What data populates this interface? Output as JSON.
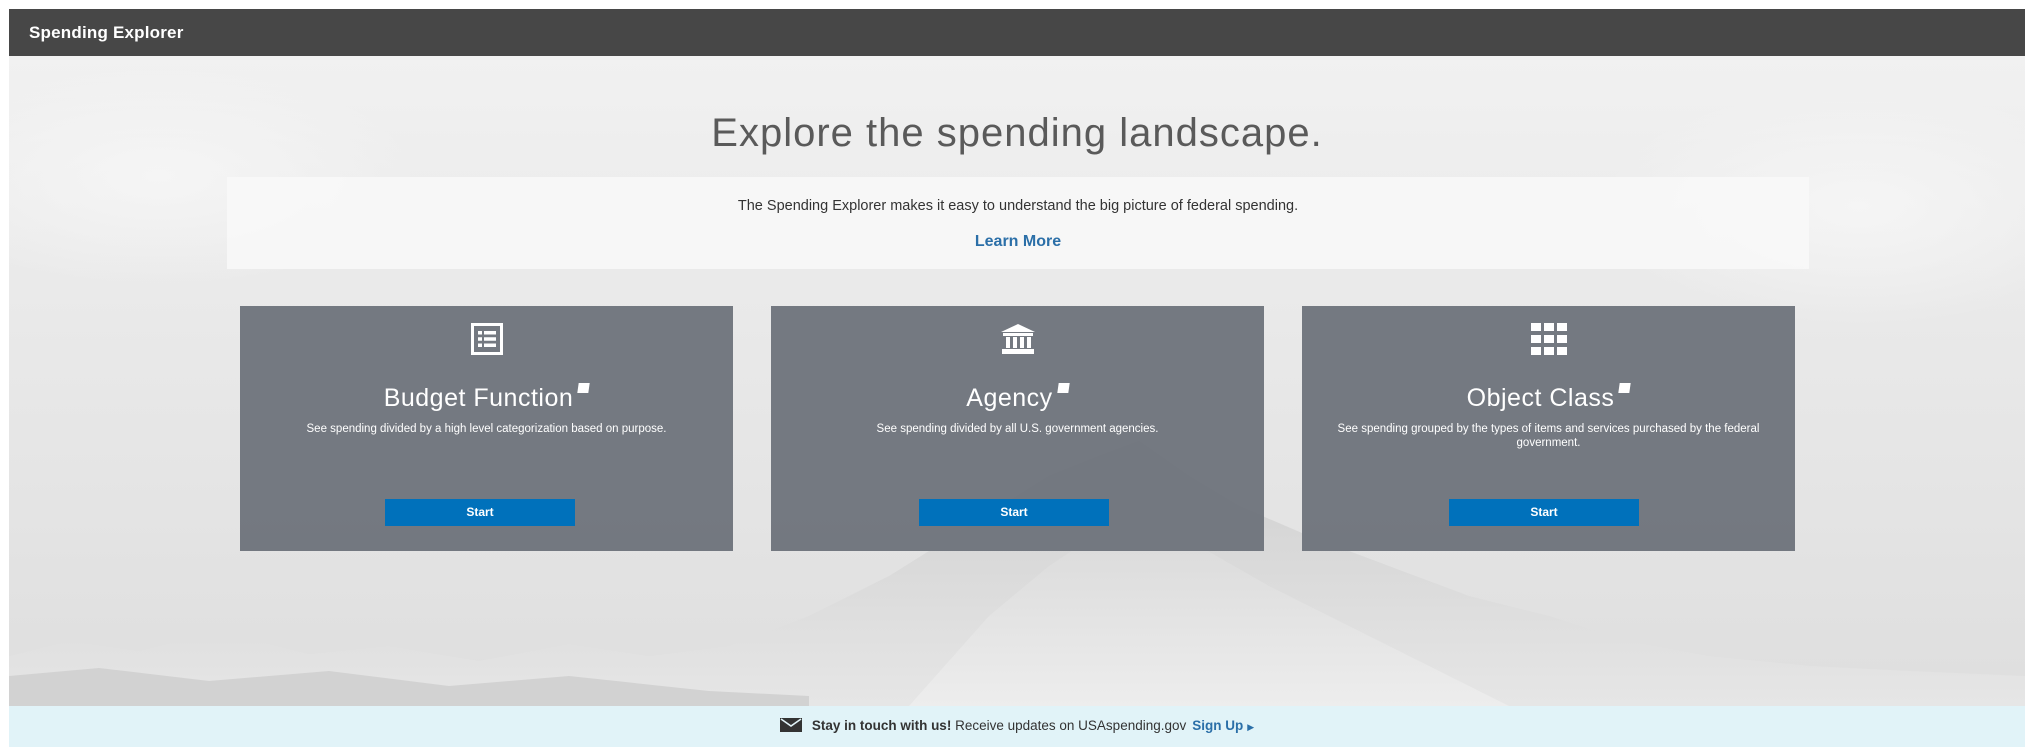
{
  "header": {
    "title": "Spending Explorer"
  },
  "hero": {
    "title": "Explore the spending landscape.",
    "intro": "The Spending Explorer makes it easy to understand the big picture of federal spending.",
    "learn_more": "Learn More"
  },
  "cards": [
    {
      "icon": "list-icon",
      "title": "Budget Function",
      "description": "See spending divided by a high level categorization based on purpose.",
      "button": "Start"
    },
    {
      "icon": "building-icon",
      "title": "Agency",
      "description": "See spending divided by all U.S. government agencies.",
      "button": "Start"
    },
    {
      "icon": "grid-icon",
      "title": "Object Class",
      "description": "See spending grouped by the types of items and services purchased by the federal government.",
      "button": "Start"
    }
  ],
  "footer": {
    "icon": "envelope-icon",
    "stay": "Stay in touch with us!",
    "text": "Receive updates on USAspending.gov",
    "signup": "Sign Up"
  },
  "colors": {
    "topbar": "#474747",
    "card": "#70757d",
    "button": "#0071bb",
    "link": "#2b6fa8",
    "footer": "#e1f3f8"
  }
}
